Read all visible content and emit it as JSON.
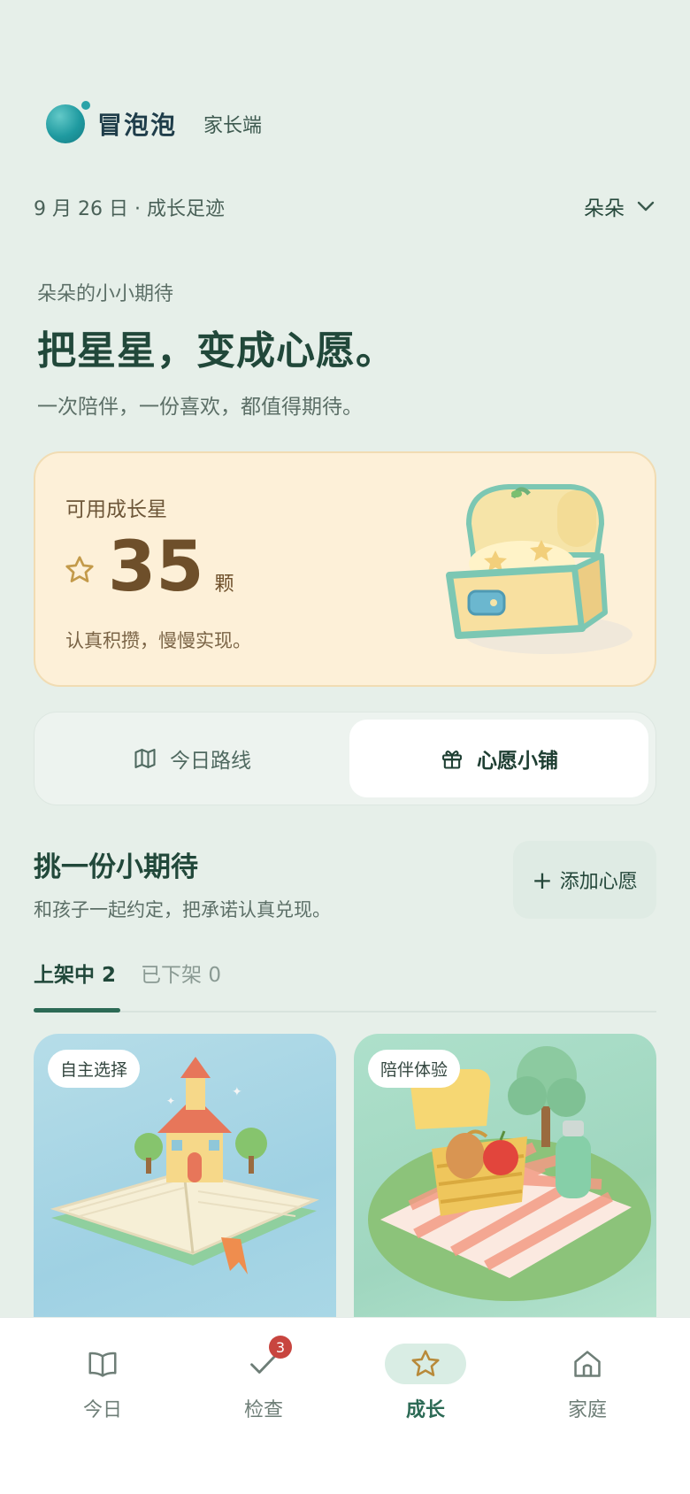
{
  "brand": {
    "name": "冒泡泡",
    "role": "家长端"
  },
  "header": {
    "date_line": "9 月 26 日 · 成长足迹",
    "child_name": "朵朵"
  },
  "hero": {
    "kicker": "朵朵的小小期待",
    "title": "把星星，变成心愿。",
    "subtitle": "一次陪伴，一份喜欢，都值得期待。"
  },
  "star_card": {
    "label": "可用成长星",
    "count": "35",
    "unit": "颗",
    "desc": "认真积攒，慢慢实现。"
  },
  "segment": {
    "left_label": "今日路线",
    "right_label": "心愿小铺",
    "active": "right"
  },
  "section": {
    "title": "挑一份小期待",
    "subtitle": "和孩子一起约定，把承诺认真兑现。",
    "add_label": "添加心愿"
  },
  "tabs": [
    {
      "label": "上架中 2",
      "active": true
    },
    {
      "label": "已下架 0",
      "active": false
    }
  ],
  "cards": [
    {
      "chip": "自主选择",
      "icon": "storybook-house-illustration"
    },
    {
      "chip": "陪伴体验",
      "icon": "picnic-basket-illustration"
    }
  ],
  "bottom_nav": [
    {
      "label": "今日",
      "icon": "book-icon"
    },
    {
      "label": "检查",
      "icon": "check-icon",
      "badge": "3"
    },
    {
      "label": "成长",
      "icon": "star-icon",
      "active": true
    },
    {
      "label": "家庭",
      "icon": "home-icon"
    }
  ],
  "colors": {
    "primary": "#2c6a55",
    "card_bg": "#fdf0d8",
    "badge": "#c8453f",
    "page_bg": "#e6efe9"
  }
}
